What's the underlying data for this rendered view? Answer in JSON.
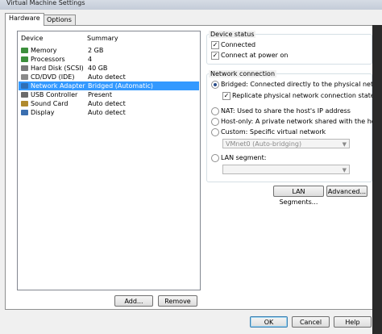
{
  "window": {
    "title": "Virtual Machine Settings"
  },
  "tabs": [
    {
      "label": "Hardware"
    },
    {
      "label": "Options"
    }
  ],
  "device_list": {
    "headers": {
      "device": "Device",
      "summary": "Summary"
    },
    "rows": [
      {
        "device": "Memory",
        "summary": "2 GB",
        "icon": "memory-icon",
        "color": "#3c8f3c"
      },
      {
        "device": "Processors",
        "summary": "4",
        "icon": "processor-icon",
        "color": "#3c8f3c"
      },
      {
        "device": "Hard Disk (SCSI)",
        "summary": "40 GB",
        "icon": "hard-disk-icon",
        "color": "#7a7a7a"
      },
      {
        "device": "CD/DVD (IDE)",
        "summary": "Auto detect",
        "icon": "cd-dvd-icon",
        "color": "#8a8a8a"
      },
      {
        "device": "Network Adapter",
        "summary": "Bridged (Automatic)",
        "icon": "network-adapter-icon",
        "color": "#2f6fb5",
        "selected": true
      },
      {
        "device": "USB Controller",
        "summary": "Present",
        "icon": "usb-icon",
        "color": "#6a6a6a"
      },
      {
        "device": "Sound Card",
        "summary": "Auto detect",
        "icon": "sound-card-icon",
        "color": "#b08a2e"
      },
      {
        "device": "Display",
        "summary": "Auto detect",
        "icon": "display-icon",
        "color": "#3a6fb0"
      }
    ],
    "add_label": "Add...",
    "remove_label": "Remove"
  },
  "device_status": {
    "legend": "Device status",
    "connected": "Connected",
    "connect_at_power_on": "Connect at power on"
  },
  "network_connection": {
    "legend": "Network connection",
    "bridged": "Bridged: Connected directly to the physical network",
    "replicate": "Replicate physical network connection state",
    "nat": "NAT: Used to share the host's IP address",
    "host_only": "Host-only: A private network shared with the host",
    "custom": "Custom: Specific virtual network",
    "custom_value": "VMnet0 (Auto-bridging)",
    "lan_segment": "LAN segment:",
    "lan_segments_button": "LAN Segments...",
    "advanced_button": "Advanced..."
  },
  "footer": {
    "ok": "OK",
    "cancel": "Cancel",
    "help": "Help"
  }
}
